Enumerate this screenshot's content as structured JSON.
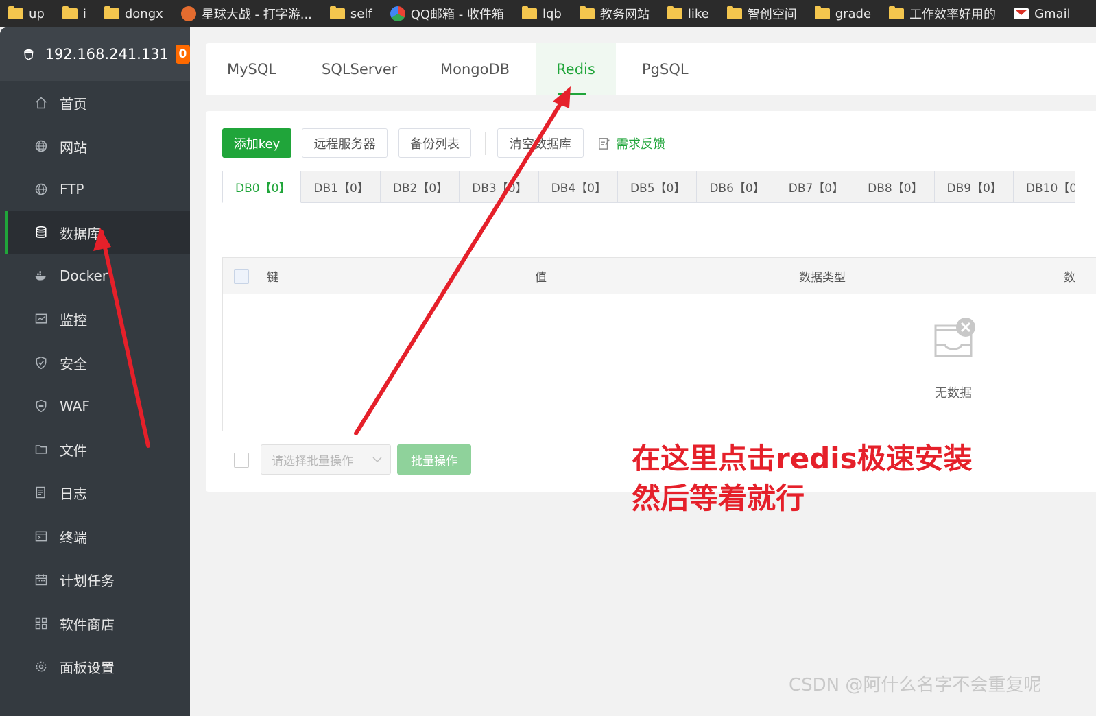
{
  "bookmarks": [
    {
      "label": "up",
      "icon": "folder-icon"
    },
    {
      "label": "i",
      "icon": "folder-icon"
    },
    {
      "label": "dongx",
      "icon": "folder-icon"
    },
    {
      "label": "星球大战 - 打字游...",
      "icon": "game-icon"
    },
    {
      "label": "self",
      "icon": "folder-icon"
    },
    {
      "label": "QQ邮箱 - 收件箱",
      "icon": "qq-mail-icon"
    },
    {
      "label": "lqb",
      "icon": "folder-icon"
    },
    {
      "label": "教务网站",
      "icon": "folder-icon"
    },
    {
      "label": "like",
      "icon": "folder-icon"
    },
    {
      "label": "智创空间",
      "icon": "folder-icon"
    },
    {
      "label": "grade",
      "icon": "folder-icon"
    },
    {
      "label": "工作效率好用的",
      "icon": "folder-icon"
    },
    {
      "label": "Gmail",
      "icon": "gmail-icon"
    }
  ],
  "server": {
    "ip": "192.168.241.131",
    "badge": "0"
  },
  "sidebar": {
    "items": [
      {
        "label": "首页",
        "icon": "home-icon"
      },
      {
        "label": "网站",
        "icon": "globe-icon"
      },
      {
        "label": "FTP",
        "icon": "ftp-globe-icon"
      },
      {
        "label": "数据库",
        "icon": "database-icon",
        "active": true
      },
      {
        "label": "Docker",
        "icon": "docker-icon"
      },
      {
        "label": "监控",
        "icon": "monitor-icon"
      },
      {
        "label": "安全",
        "icon": "shield-icon"
      },
      {
        "label": "WAF",
        "icon": "waf-icon"
      },
      {
        "label": "文件",
        "icon": "folder-icon"
      },
      {
        "label": "日志",
        "icon": "log-icon"
      },
      {
        "label": "终端",
        "icon": "terminal-icon"
      },
      {
        "label": "计划任务",
        "icon": "calendar-icon"
      },
      {
        "label": "软件商店",
        "icon": "grid-icon"
      },
      {
        "label": "面板设置",
        "icon": "gear-icon"
      }
    ]
  },
  "db_tabs": {
    "items": [
      "MySQL",
      "SQLServer",
      "MongoDB",
      "Redis",
      "PgSQL"
    ],
    "active": "Redis"
  },
  "toolbar": {
    "add_key": "添加key",
    "remote_server": "远程服务器",
    "backup_list": "备份列表",
    "clear_db": "清空数据库",
    "feedback": "需求反馈"
  },
  "redis_dbs": [
    "DB0【0】",
    "DB1【0】",
    "DB2【0】",
    "DB3【0】",
    "DB4【0】",
    "DB5【0】",
    "DB6【0】",
    "DB7【0】",
    "DB8【0】",
    "DB9【0】",
    "DB10【0"
  ],
  "table": {
    "headers": [
      "键",
      "值",
      "数据类型",
      "数"
    ],
    "empty_text": "无数据"
  },
  "batch": {
    "placeholder": "请选择批量操作",
    "button": "批量操作"
  },
  "annotation": {
    "line1": "在这里点击redis极速安装",
    "line2": "然后等着就行"
  },
  "watermark": "CSDN @阿什么名字不会重复呢",
  "colors": {
    "accent": "#20a53a",
    "badge": "#ff6a00",
    "annotation": "#e5202a",
    "sidebar": "#343a40"
  }
}
